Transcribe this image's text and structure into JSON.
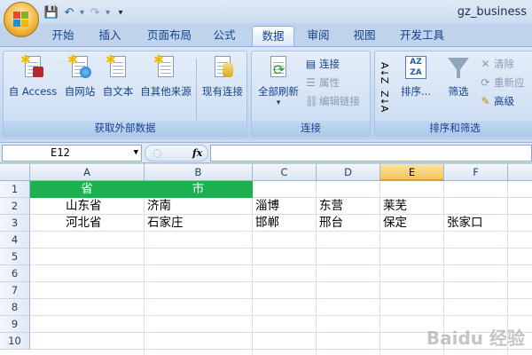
{
  "window": {
    "title": "gz_business"
  },
  "quick_access": {
    "save": "💾",
    "undo": "↶",
    "redo": "↷",
    "customize": "▾"
  },
  "tabs": [
    "开始",
    "插入",
    "页面布局",
    "公式",
    "数据",
    "审阅",
    "视图",
    "开发工具"
  ],
  "active_tab": "数据",
  "ribbon": {
    "external_data": {
      "label": "获取外部数据",
      "buttons": [
        "自 Access",
        "自网站",
        "自文本",
        "自其他来源",
        "现有连接"
      ]
    },
    "connections": {
      "label": "连接",
      "refresh_all": "全部刷新",
      "connections": "连接",
      "properties": "属性",
      "edit_links": "编辑链接"
    },
    "sort_filter": {
      "label": "排序和筛选",
      "sort": "排序...",
      "filter": "筛选",
      "clear": "清除",
      "reapply": "重新应",
      "advanced": "高级",
      "az_label": "A↓Z",
      "za_label": "Z↓A"
    }
  },
  "formula_bar": {
    "name_box": "E12",
    "fx": "fx",
    "formula": ""
  },
  "sheet": {
    "columns": [
      "A",
      "B",
      "C",
      "D",
      "E",
      "F"
    ],
    "selected_column": "E",
    "rows": [
      "1",
      "2",
      "3",
      "4",
      "5",
      "6",
      "7",
      "8",
      "9",
      "10"
    ],
    "cells": {
      "A1": "省",
      "B1": "市",
      "A2": "山东省",
      "B2": "济南",
      "C2": "淄博",
      "D2": "东营",
      "E2": "莱芜",
      "A3": "河北省",
      "B3": "石家庄",
      "C3": "邯郸",
      "D3": "邢台",
      "E3": "保定",
      "F3": "张家口"
    }
  },
  "colors": {
    "header_fill": "#1cb04f",
    "selected_col": "#f5c35c"
  },
  "watermark": "Baidu 经验"
}
